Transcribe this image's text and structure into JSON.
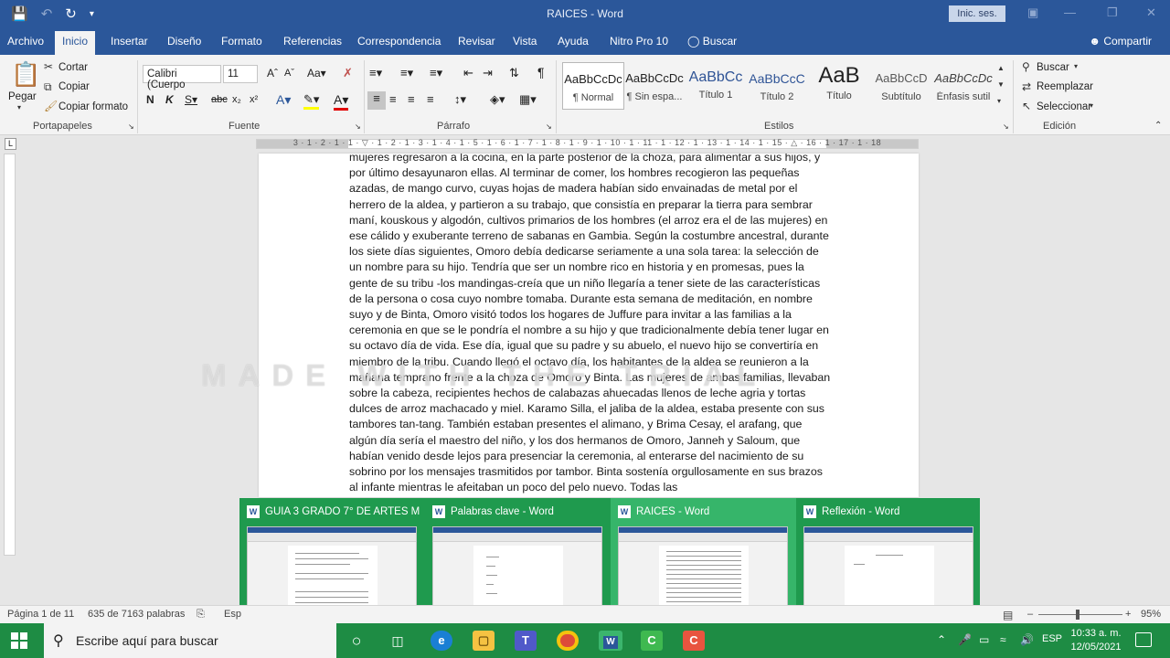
{
  "window": {
    "title": "RAICES - Word",
    "signin_label": "Inic. ses."
  },
  "tabs": [
    {
      "label": "Archivo"
    },
    {
      "label": "Inicio"
    },
    {
      "label": "Insertar"
    },
    {
      "label": "Diseño"
    },
    {
      "label": "Formato"
    },
    {
      "label": "Referencias"
    },
    {
      "label": "Correspondencia"
    },
    {
      "label": "Revisar"
    },
    {
      "label": "Vista"
    },
    {
      "label": "Ayuda"
    },
    {
      "label": "Nitro Pro 10"
    },
    {
      "label": "Buscar"
    }
  ],
  "share_label": "Compartir",
  "ribbon": {
    "clipboard": {
      "paste": "Pegar",
      "cut": "Cortar",
      "copy": "Copiar",
      "format_painter": "Copiar formato",
      "label": "Portapapeles"
    },
    "font": {
      "family": "Calibri (Cuerpo",
      "size": "11",
      "label": "Fuente"
    },
    "paragraph": {
      "label": "Párrafo"
    },
    "styles": {
      "label": "Estilos",
      "items": [
        {
          "preview": "AaBbCcDc",
          "name": "¶ Normal"
        },
        {
          "preview": "AaBbCcDc",
          "name": "¶ Sin espa..."
        },
        {
          "preview": "AaBbCc",
          "name": "Título 1"
        },
        {
          "preview": "AaBbCcC",
          "name": "Título 2"
        },
        {
          "preview": "AaB",
          "name": "Título"
        },
        {
          "preview": "AaBbCcD",
          "name": "Subtítulo"
        },
        {
          "preview": "AaBbCcDc",
          "name": "Énfasis sutil"
        }
      ]
    },
    "editing": {
      "find": "Buscar",
      "replace": "Reemplazar",
      "select": "Seleccionar",
      "label": "Edición"
    }
  },
  "ruler": {
    "numbers": "3 · 1 · 2 · 1 · 1 · ▽ · 1 · 2 · 1 · 3 · 1 · 4 · 1 · 5 · 1 · 6 · 1 · 7 · 1 · 8 · 1 · 9 · 1 · 10 · 1 · 11 · 1 · 12 · 1 · 13 · 1 · 14 · 1 · 15 · △ · 16 · 1 · 17 · 1 · 18"
  },
  "document": {
    "text": "mujeres regresaron a la cocina, en la parte posterior de la choza, para alimentar a sus hijos, y por último desayunaron ellas. Al terminar de comer, los hombres recogieron las pequeñas azadas, de mango curvo, cuyas hojas de madera habían sido envainadas de metal por el herrero de la aldea, y partieron a su trabajo, que consistía en preparar la tierra para sembrar maní, kouskous y algodón, cultivos primarios de los hombres (el arroz era el de las mujeres) en ese cálido y exuberante terreno de sabanas en Gambia. Según la costumbre ancestral, durante los siete días siguientes, Omoro debía dedicarse seriamente a una sola tarea: la selección de un nombre para su hijo. Tendría que ser un nombre rico en historia y en promesas, pues la gente de su tribu -los mandingas-creía que un niño llegaría a tener siete de las características de la persona o cosa cuyo nombre tomaba. Durante esta semana de meditación, en nombre suyo y de Binta, Omoro visitó todos los hogares de Juffure para invitar a las familias a la ceremonia en que se le pondría el nombre a su hijo y que tradicionalmente debía tener lugar en su octavo día de vida. Ese día, igual que su padre y su abuelo, el nuevo hijo se convertiría en miembro de la tribu. Cuando llegó el octavo día, los habitantes de la aldea se reunieron a la mañana temprano frente a la choza de Omoro y Binta. Las mujeres de ambas familias, llevaban sobre la cabeza, recipientes hechos de calabazas ahuecadas llenos de leche agria y tortas dulces de arroz machacado y miel. Karamo Silla, el jaliba de la aldea, estaba presente con sus tambores tan-tang. También estaban presentes el alimano, y Brima Cesay, el arafang, que algún día sería el maestro del niño, y los dos hermanos de Omoro, Janneh y Saloum, que habían venido desde lejos para presenciar la ceremonia, al enterarse del nacimiento de su sobrino por los mensajes trasmitidos por tambor. Binta sostenía orgullosamente en sus brazos al infante mientras le afeitaban un poco del pelo nuevo. Todas las"
  },
  "watermark": "MADE WITH THE TRIAL",
  "preview_windows": [
    {
      "title": "GUIA 3  GRADO 7° DE ARTES M..."
    },
    {
      "title": "Palabras clave - Word"
    },
    {
      "title": "RAICES - Word"
    },
    {
      "title": "Reflexión - Word"
    }
  ],
  "status": {
    "page": "Página 1 de 11",
    "words": "635 de 7163 palabras",
    "lang": "Esp",
    "zoom": "95%"
  },
  "taskbar": {
    "search_placeholder": "Escribe aquí para buscar",
    "lang": "ESP",
    "time": "10:33 a. m.",
    "date": "12/05/2021"
  },
  "colors": {
    "word_blue": "#2b579a",
    "taskbar_green": "#1e8c44",
    "preview_green": "#1f9a4e"
  }
}
